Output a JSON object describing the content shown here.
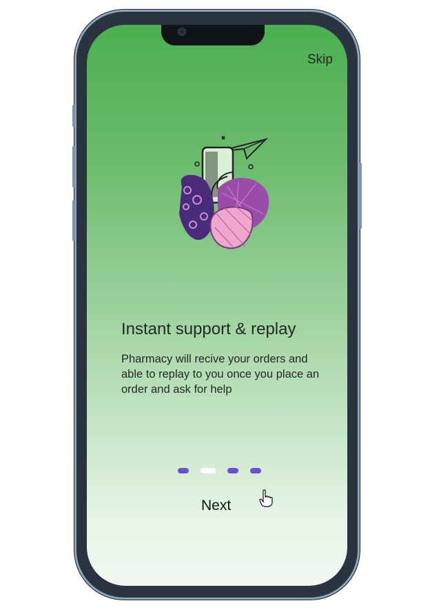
{
  "header": {
    "skip_label": "Skip"
  },
  "onboarding": {
    "title": "Instant support & replay",
    "description": "Pharmacy will recive your orders and able to replay to you once you place an order and ask for help",
    "next_label": "Next",
    "page_indicator": {
      "total": 4,
      "current": 2
    }
  },
  "colors": {
    "gradient_top": "#4caf50",
    "gradient_bottom": "#f1f8f1",
    "dot_inactive": "#6a4fd0",
    "dot_active": "#ffffff",
    "illustration_dark": "#4a2a7a",
    "illustration_mid": "#9b4ba8",
    "illustration_light": "#f2a6cc"
  },
  "icons": {
    "illustration": "phone-support-illustration",
    "cursor": "hand-pointer-icon"
  }
}
